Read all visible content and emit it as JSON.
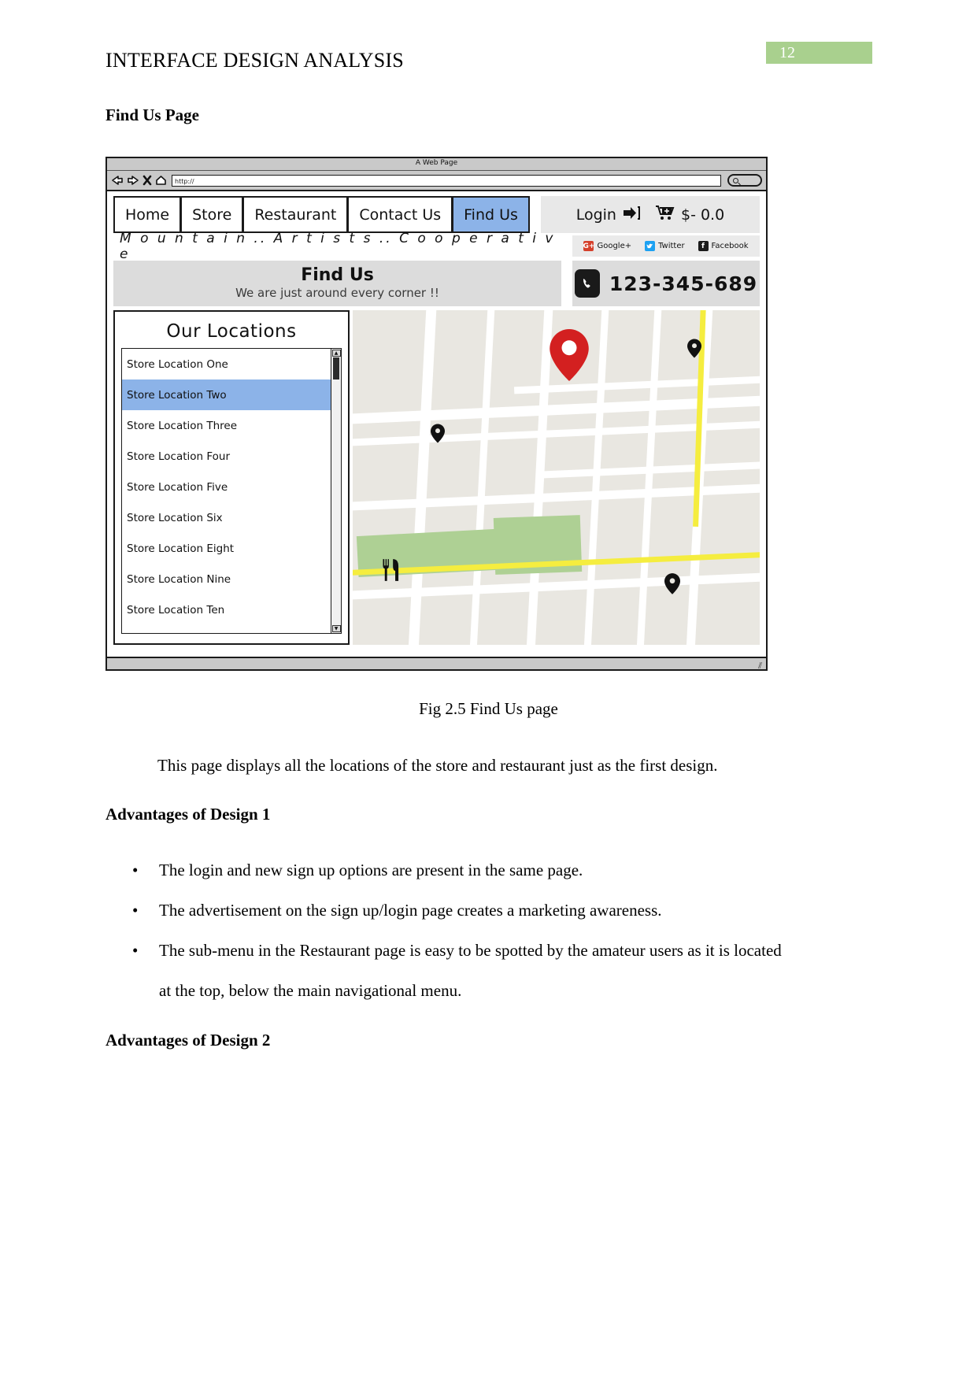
{
  "document": {
    "header_title": "INTERFACE DESIGN ANALYSIS",
    "page_number": "12",
    "section_heading": "Find Us Page",
    "figure_caption": "Fig 2.5 Find Us page",
    "paragraph": "This page displays all the locations of the store and restaurant just as the first design.",
    "adv1_heading": "Advantages of Design 1",
    "adv2_heading": "Advantages of Design 2",
    "bullets": [
      "The login and new sign up options are present in the same page.",
      "The advertisement on the sign up/login page creates a marketing awareness.",
      "The sub-menu in the Restaurant page is easy to be spotted by the amateur users as it is located at the top, below the main navigational menu."
    ]
  },
  "browser": {
    "window_title": "A Web Page",
    "url_value": "http://",
    "nav_icons": [
      "back-arrow-icon",
      "forward-arrow-icon",
      "stop-x-icon",
      "home-icon"
    ],
    "search_icon": "magnifier-icon"
  },
  "site": {
    "nav": [
      {
        "label": "Home",
        "active": false
      },
      {
        "label": "Store",
        "active": false
      },
      {
        "label": "Restaurant",
        "active": false
      },
      {
        "label": "Contact Us",
        "active": false
      },
      {
        "label": "Find Us",
        "active": true
      }
    ],
    "user_actions": {
      "login_label": "Login",
      "login_icon": "login-arrow-icon",
      "cart_icon": "shopping-cart-icon",
      "cart_total": "$- 0.0"
    },
    "brand": "M o u n t a i n .. A r t i s t s .. C o o p e r a t i v e",
    "socials": [
      {
        "label": "Google+",
        "icon": "google-plus-icon",
        "glyph": "G+"
      },
      {
        "label": "Twitter",
        "icon": "twitter-icon",
        "glyph": "t"
      },
      {
        "label": "Facebook",
        "icon": "facebook-icon",
        "glyph": "f"
      }
    ],
    "hero": {
      "title": "Find Us",
      "tagline": "We are just around every corner !!"
    },
    "phone": {
      "icon": "phone-icon",
      "number": "123-345-689"
    },
    "locations_panel": {
      "title": "Our Locations",
      "items": [
        {
          "label": "Store Location One",
          "selected": false
        },
        {
          "label": "Store Location Two",
          "selected": true
        },
        {
          "label": "Store Location Three",
          "selected": false
        },
        {
          "label": "Store Location Four",
          "selected": false
        },
        {
          "label": "Store Location Five",
          "selected": false
        },
        {
          "label": "Store Location Six",
          "selected": false
        },
        {
          "label": "Store Location Eight",
          "selected": false
        },
        {
          "label": "Store Location Nine",
          "selected": false
        },
        {
          "label": "Store Location Ten",
          "selected": false
        }
      ],
      "scroll_up": "▲",
      "scroll_down": "▼"
    },
    "map": {
      "markers": [
        {
          "name": "primary-location-marker",
          "color": "#d32020",
          "size": "large"
        },
        {
          "name": "location-marker",
          "color": "#111111",
          "size": "small"
        },
        {
          "name": "location-marker",
          "color": "#111111",
          "size": "small"
        },
        {
          "name": "location-marker",
          "color": "#111111",
          "size": "small"
        },
        {
          "name": "restaurant-marker",
          "color": "#111111",
          "size": "small"
        }
      ],
      "colors": {
        "land": "#e9e7e1",
        "road": "#ffffff",
        "highway": "#f5ed3f",
        "park": "#aed094"
      }
    }
  }
}
